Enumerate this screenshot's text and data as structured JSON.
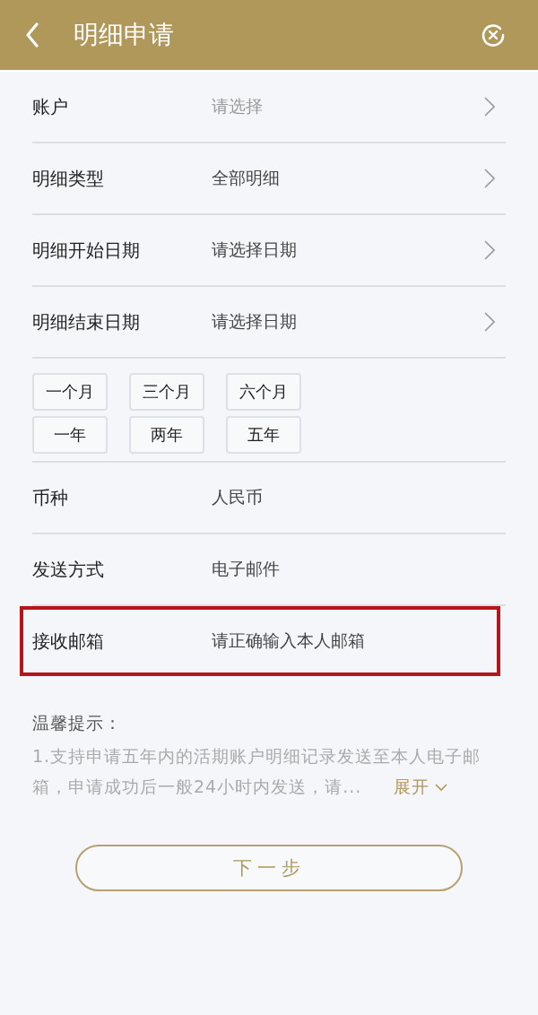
{
  "header": {
    "title": "明细申请"
  },
  "form_rows": [
    {
      "label": "账户",
      "placeholder": "请选择",
      "chevron": true
    },
    {
      "label": "明细类型",
      "value": "全部明细",
      "chevron": true
    },
    {
      "label": "明细开始日期",
      "value": "请选择日期",
      "chevron": true
    },
    {
      "label": "明细结束日期",
      "value": "请选择日期",
      "chevron": true
    }
  ],
  "period_buttons": [
    "一个月",
    "三个月",
    "六个月",
    "一年",
    "两年",
    "五年"
  ],
  "form_rows_2": [
    {
      "label": "币种",
      "value": "人民币"
    },
    {
      "label": "发送方式",
      "value": "电子邮件"
    },
    {
      "label": "接收邮箱",
      "value": "请正确输入本人邮箱",
      "highlighted": true
    }
  ],
  "tips": {
    "title": "温馨提示：",
    "text": "1.支持申请五年内的活期账户明细记录发送至本人电子邮箱，申请成功后一般24小时内发送，请...",
    "expand": "展开"
  },
  "next_button": "下一步"
}
